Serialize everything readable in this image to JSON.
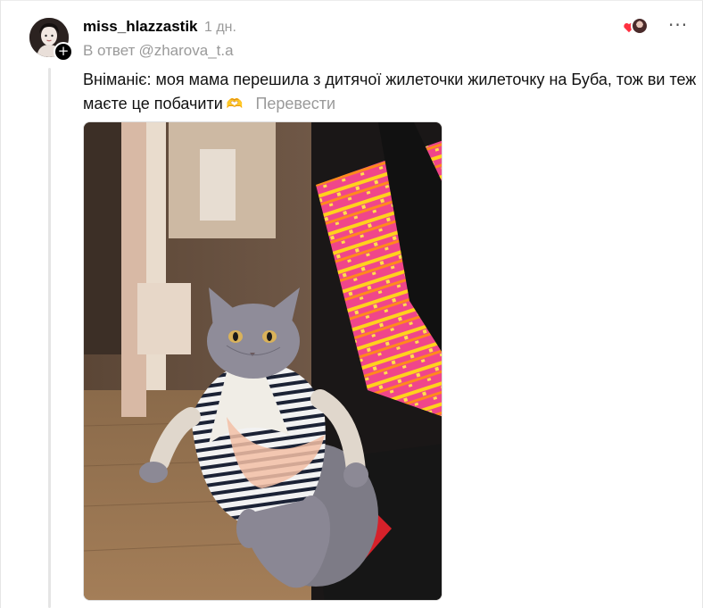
{
  "post": {
    "username": "miss_hlazzastik",
    "time": "1 дн.",
    "reply_prefix": "В ответ",
    "reply_to": "@zharova_t.a",
    "text": "Вніманіє: моя мама перешила з дитячої жилеточки жилеточку на Буба, тож ви теж маєте це побачити",
    "emoji": "🫶",
    "translate_label": "Перевести",
    "more_label": "···",
    "follow_label": "+"
  },
  "colors": {
    "heart": "#ff3040",
    "muted_text": "#9a9a9a",
    "thread_line": "#e5e5e5"
  },
  "icons": {
    "heart": "heart-icon",
    "more": "more-icon",
    "follow": "plus-icon"
  }
}
